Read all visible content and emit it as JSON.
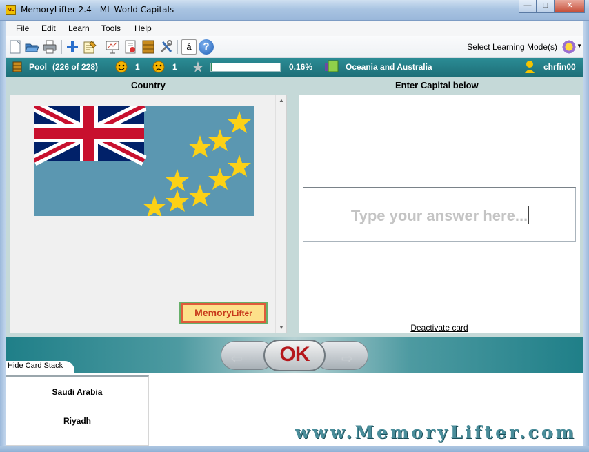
{
  "window": {
    "title": "MemoryLifter 2.4 - ML World Capitals",
    "icon_text": "ML"
  },
  "menu": [
    "File",
    "Edit",
    "Learn",
    "Tools",
    "Help"
  ],
  "toolbar": {
    "icons": [
      "new-icon",
      "open-icon",
      "print-icon",
      "add-icon",
      "edit-icon",
      "presentation-icon",
      "statistics-icon",
      "box-icon",
      "settings-icon",
      "special-char-icon",
      "help-icon"
    ],
    "special_char": "á",
    "help_char": "?",
    "mode_label": "Select Learning Mode(s)"
  },
  "status": {
    "pool_label": "Pool",
    "pool_count": "(226 of 228)",
    "right_count": "1",
    "wrong_count": "1",
    "progress_percent": 0.16,
    "progress_text": "0.16%",
    "chapter": "Oceania and Australia",
    "user": "chrfin00"
  },
  "card": {
    "question_header": "Country",
    "answer_header": "Enter Capital below",
    "answer_placeholder": "Type your answer here...",
    "deactivate_label": "Deactivate card",
    "logo_text_1": "Memory",
    "logo_text_2": "Lifter"
  },
  "nav": {
    "ok_label": "OK",
    "prev_arrow": "⇦",
    "next_arrow": "⇨"
  },
  "stack": {
    "hide_label": "Hide Card Stack",
    "last_question": "Saudi Arabia",
    "last_answer": "Riyadh"
  },
  "footer": {
    "website": "www.MemoryLifter.com"
  }
}
